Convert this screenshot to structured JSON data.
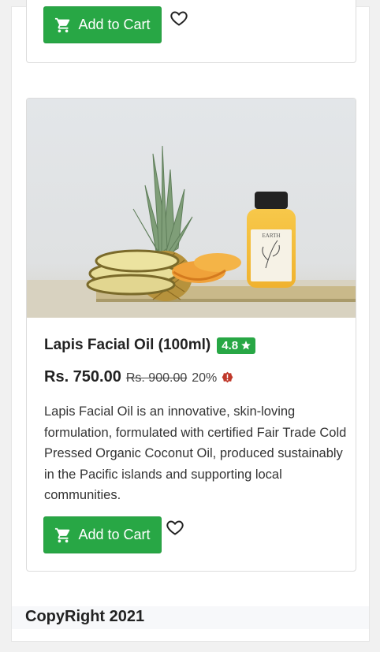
{
  "top_card": {
    "add_to_cart_label": "Add to Cart"
  },
  "product": {
    "title": "Lapis Facial Oil (100ml)",
    "rating": "4.8",
    "price": "Rs. 750.00",
    "old_price": "Rs. 900.00",
    "discount": "20%",
    "description": "Lapis Facial Oil is an innovative, skin-loving formulation, formulated with certified Fair Trade Cold Pressed Organic Coconut Oil, produced sustainably in the Pacific islands and supporting local communities.",
    "add_to_cart_label": "Add to Cart",
    "image_label": "EARTH"
  },
  "footer": {
    "copyright": "CopyRight 2021"
  },
  "colors": {
    "accent_green": "#28a745",
    "alert_red": "#c0392b"
  },
  "icons": {
    "cart": "cart-icon",
    "wishlist": "heart-icon",
    "rating": "star-icon",
    "alert": "alert-icon"
  }
}
